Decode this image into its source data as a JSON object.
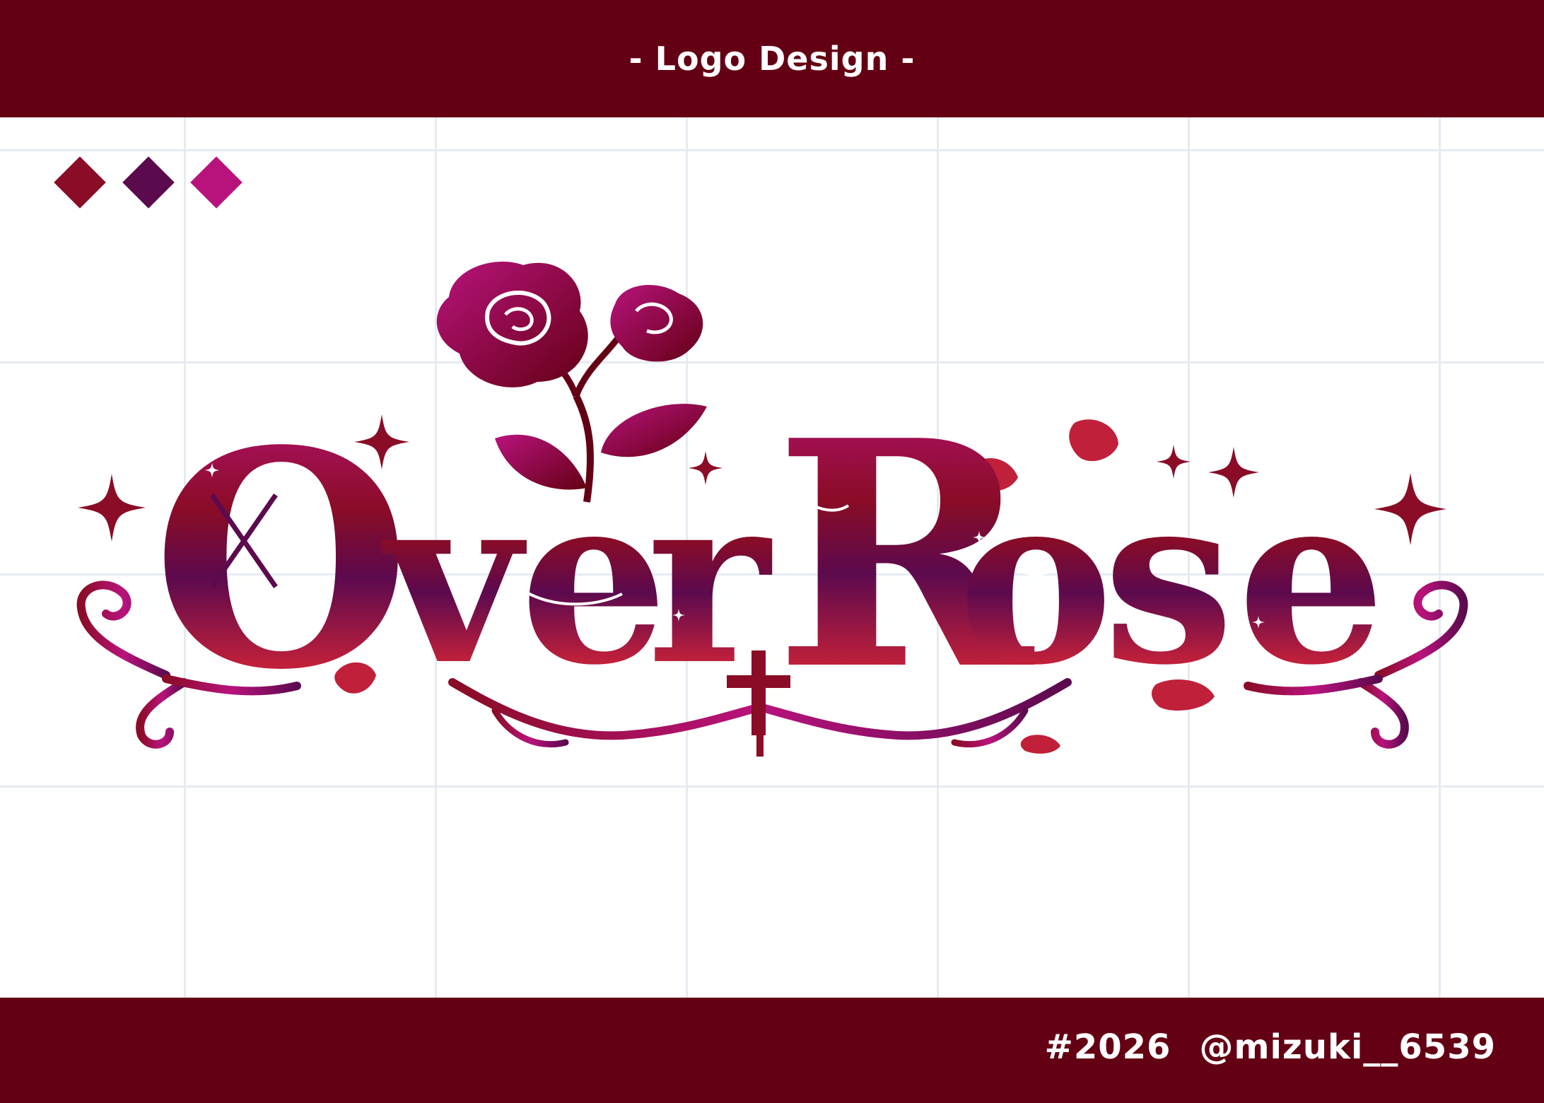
{
  "header": {
    "title": "- Logo Design -"
  },
  "palette": {
    "swatches": [
      "#8a0c26",
      "#5c0a4e",
      "#b8137c"
    ]
  },
  "logo": {
    "wordmark": "OverRose",
    "letters": [
      "O",
      "v",
      "e",
      "r",
      "R",
      "o",
      "s",
      "e"
    ],
    "icons": [
      "rose-icon",
      "sparkle-icon",
      "petal-icon",
      "cross-icon",
      "chain-icon",
      "scroll-flourish-icon"
    ],
    "colors": {
      "crimson": "#8a0c26",
      "plum": "#5c0a4e",
      "magenta": "#b8137c",
      "petal": "#c0203a",
      "banner": "#640014"
    }
  },
  "footer": {
    "tag": "#2026",
    "handle": "@mizuki__6539"
  }
}
